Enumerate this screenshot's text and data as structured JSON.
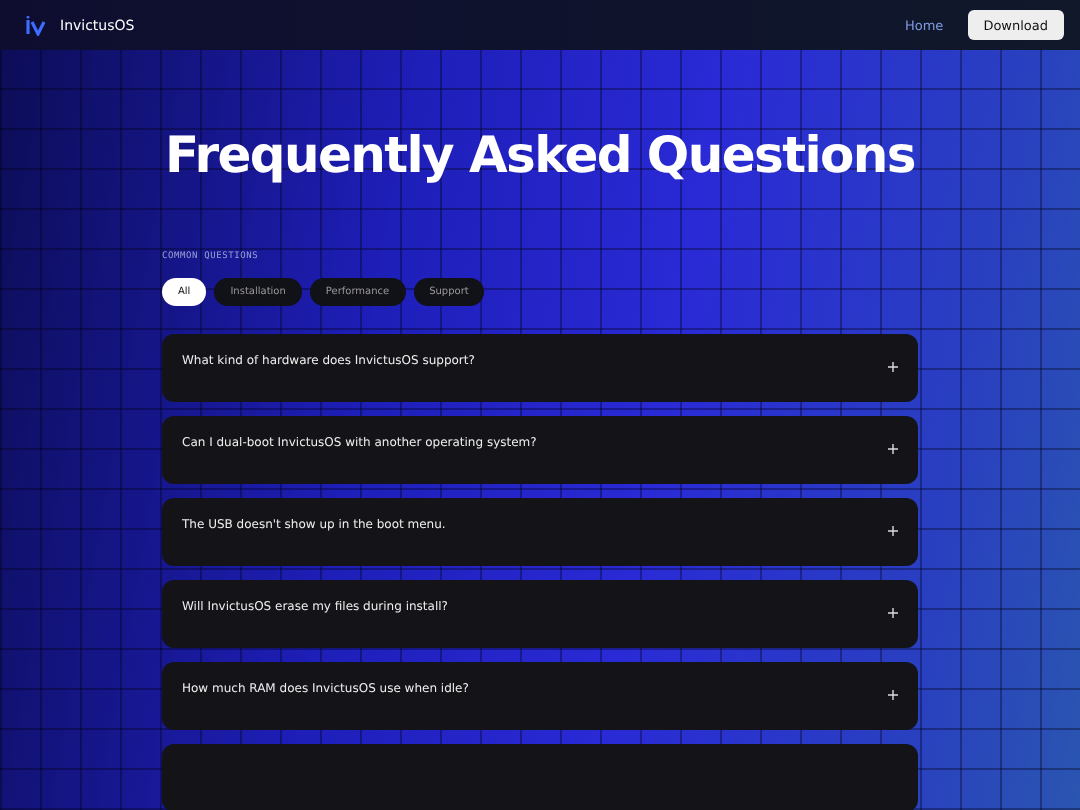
{
  "header": {
    "brand": "InvictusOS",
    "nav": [
      {
        "label": "Home",
        "selected": true
      }
    ],
    "button": "Download"
  },
  "hero": {
    "title": "Frequently Asked Questions"
  },
  "section_label": "COMMON QUESTIONS",
  "filters": [
    {
      "label": "All",
      "selected": true
    },
    {
      "label": "Installation",
      "selected": false
    },
    {
      "label": "Performance",
      "selected": false
    },
    {
      "label": "Support",
      "selected": false
    }
  ],
  "faqs": [
    {
      "question": "What kind of hardware does InvictusOS support?",
      "expanded": false
    },
    {
      "question": "Can I dual-boot InvictusOS with another operating system?",
      "expanded": false
    },
    {
      "question": "The USB doesn't show up in the boot menu.",
      "expanded": false
    },
    {
      "question": "Will InvictusOS erase my files during install?",
      "expanded": false
    },
    {
      "question": "How much RAM does InvictusOS use when idle?",
      "expanded": false
    }
  ]
}
